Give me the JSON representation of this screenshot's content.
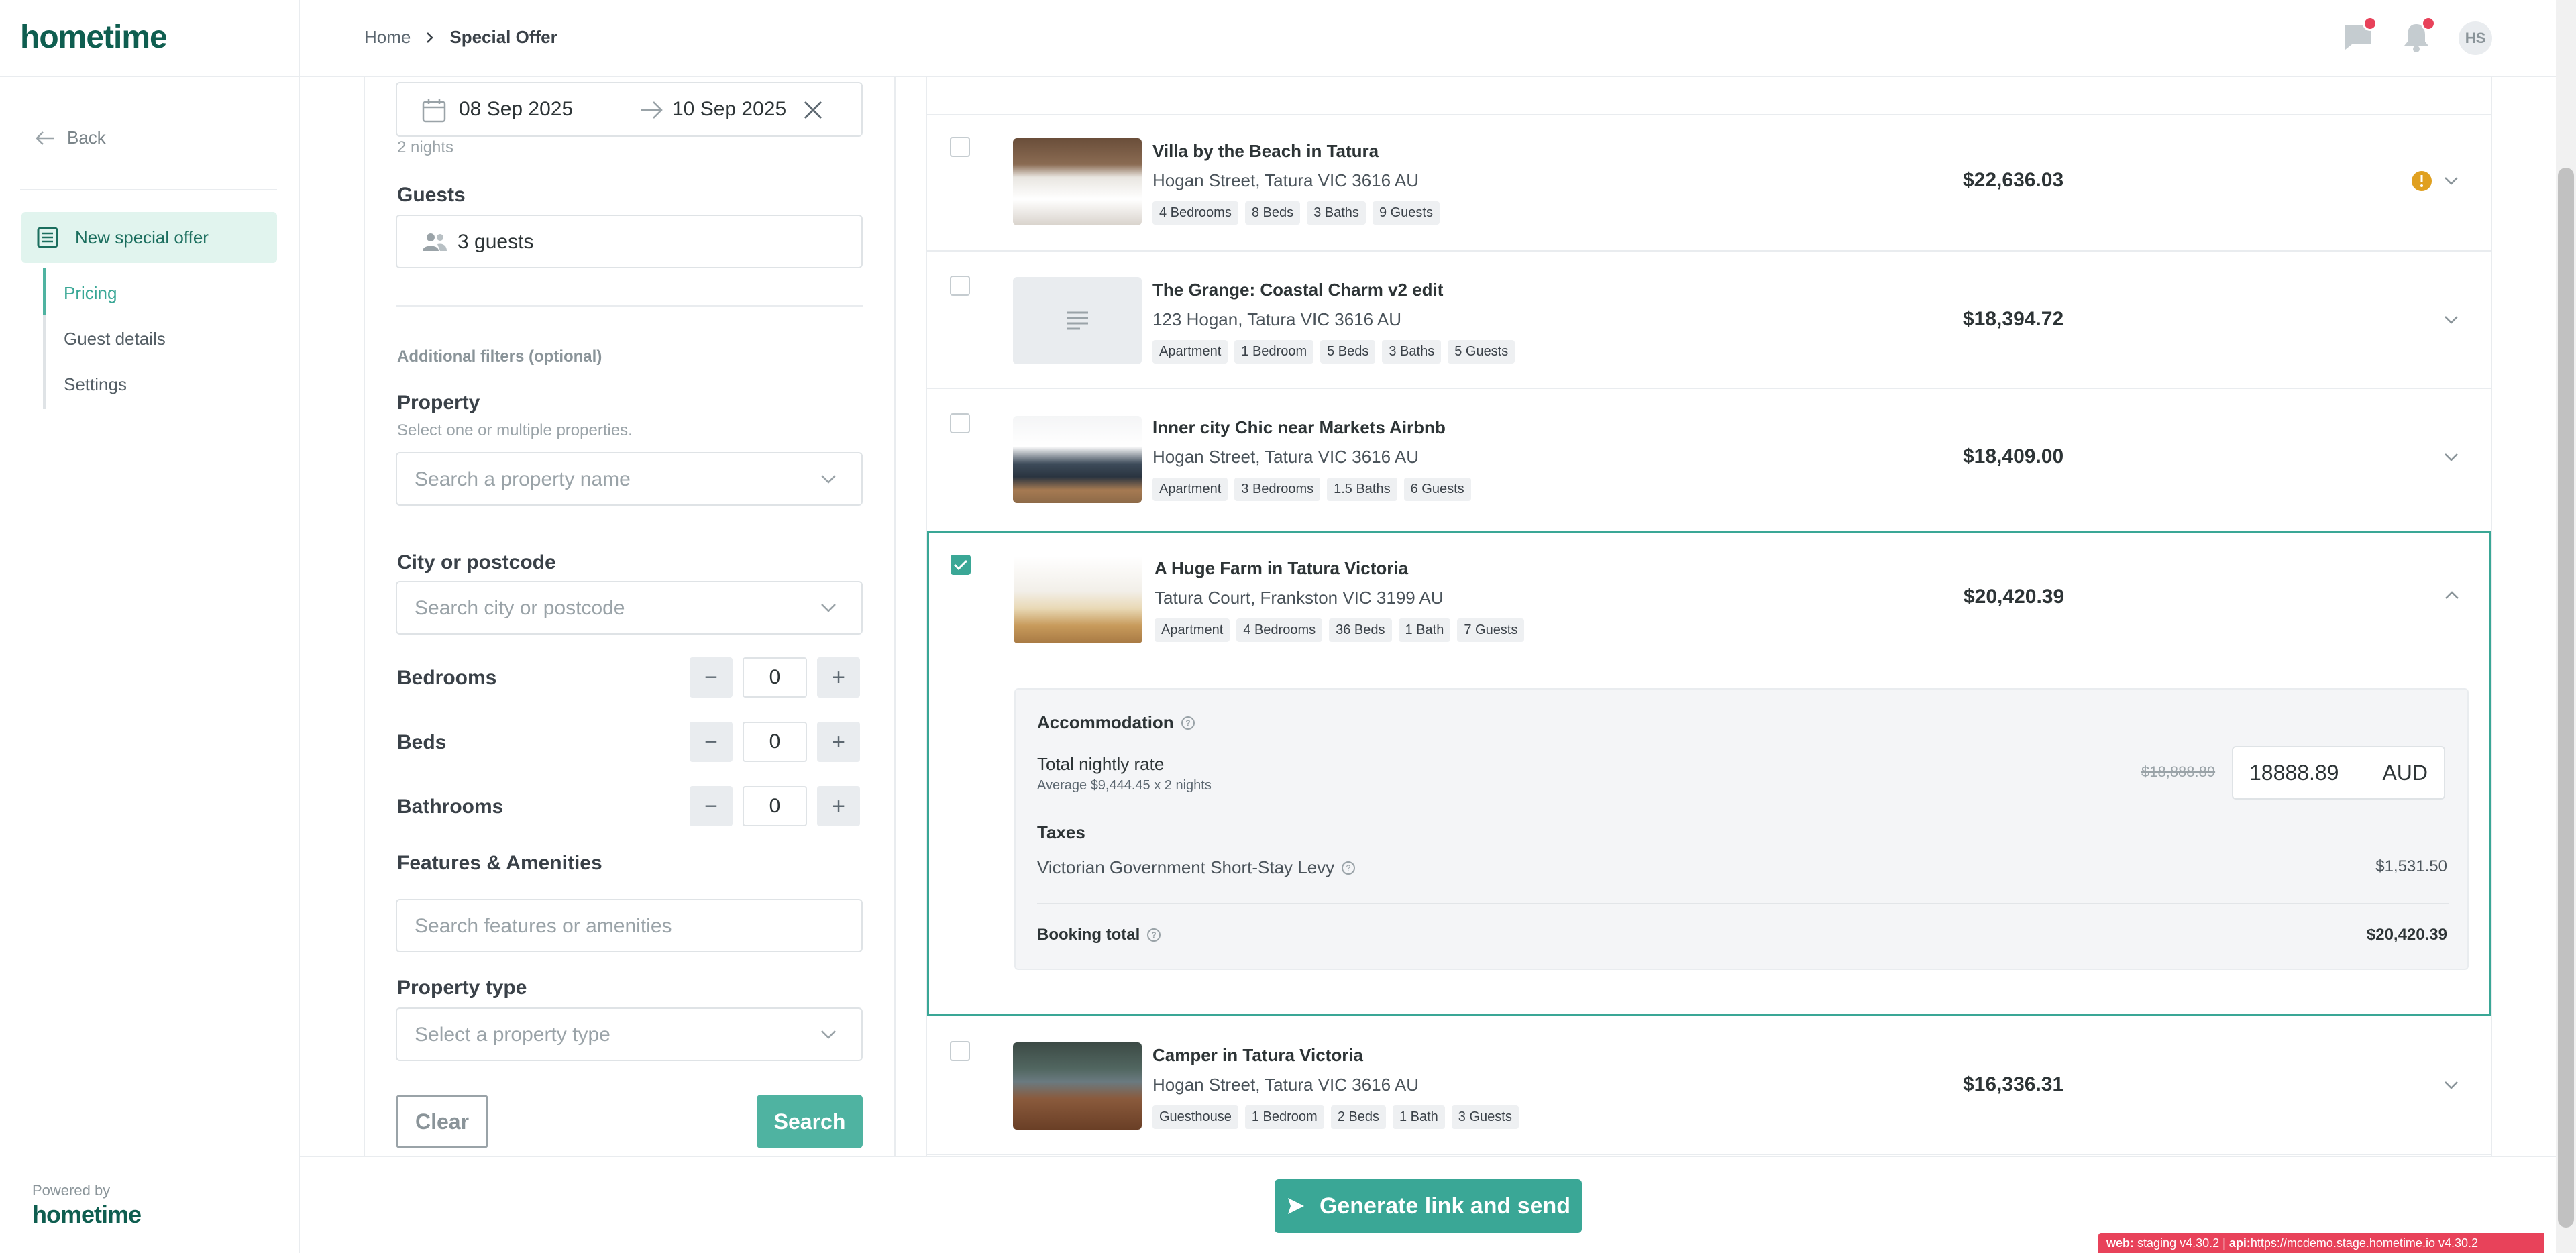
{
  "header": {
    "logo": "hometime",
    "breadcrumb": {
      "home": "Home",
      "current": "Special Offer"
    },
    "avatar": "HS"
  },
  "nav": {
    "back": "Back",
    "new_offer": "New special offer",
    "sub_items": [
      "Pricing",
      "Guest details",
      "Settings"
    ],
    "powered_by": "Powered by",
    "powered_logo": "hometime"
  },
  "form": {
    "check_in": "08 Sep 2025",
    "check_out": "10 Sep 2025",
    "nights": "2 nights",
    "guests_label": "Guests",
    "guests_value": "3 guests",
    "additional_filters": "Additional filters (optional)",
    "property_label": "Property",
    "property_hint": "Select one or multiple properties.",
    "property_placeholder": "Search a property name",
    "city_label": "City or postcode",
    "city_placeholder": "Search city or postcode",
    "bedrooms_label": "Bedrooms",
    "bedrooms_value": "0",
    "beds_label": "Beds",
    "beds_value": "0",
    "bathrooms_label": "Bathrooms",
    "bathrooms_value": "0",
    "features_label": "Features & Amenities",
    "features_placeholder": "Search features or amenities",
    "type_label": "Property type",
    "type_placeholder": "Select a property type",
    "clear": "Clear",
    "search": "Search"
  },
  "results": [
    {
      "name": "Villa by the Beach in Tatura",
      "address": "Hogan Street, Tatura VIC 3616 AU",
      "tags": [
        "4 Bedrooms",
        "8 Beds",
        "3 Baths",
        "9 Guests"
      ],
      "price": "$22,636.03",
      "checked": false,
      "warning": true
    },
    {
      "name": "The Grange: Coastal Charm v2 edit",
      "address": "123 Hogan, Tatura VIC 3616 AU",
      "tags": [
        "Apartment",
        "1 Bedroom",
        "5 Beds",
        "3 Baths",
        "5 Guests"
      ],
      "price": "$18,394.72",
      "checked": false,
      "no_image": true
    },
    {
      "name": "Inner city Chic near Markets Airbnb",
      "address": "Hogan Street, Tatura VIC 3616 AU",
      "tags": [
        "Apartment",
        "3 Bedrooms",
        "1.5 Baths",
        "6 Guests"
      ],
      "price": "$18,409.00",
      "checked": false
    },
    {
      "name": "A Huge Farm in Tatura Victoria",
      "address": "Tatura Court, Frankston VIC 3199 AU",
      "tags": [
        "Apartment",
        "4 Bedrooms",
        "36 Beds",
        "1 Bath",
        "7 Guests"
      ],
      "price": "$20,420.39",
      "checked": true
    },
    {
      "name": "Camper in Tatura Victoria",
      "address": "Hogan Street, Tatura VIC 3616 AU",
      "tags": [
        "Guesthouse",
        "1 Bedroom",
        "2 Beds",
        "1 Bath",
        "3 Guests"
      ],
      "price": "$16,336.31",
      "checked": false
    }
  ],
  "detail": {
    "accommodation": "Accommodation",
    "nightly_label": "Total nightly rate",
    "nightly_sub": "Average $9,444.45 x 2 nights",
    "original_price": "$18,888.89",
    "rate_value": "18888.89",
    "currency": "AUD",
    "taxes": "Taxes",
    "levy_label": "Victorian Government Short-Stay Levy",
    "levy_value": "$1,531.50",
    "total_label": "Booking total",
    "total_value": "$20,420.39"
  },
  "footer": {
    "generate": "Generate link and send",
    "env_web_label": "web:",
    "env_web": "staging v4.30.2 |",
    "env_api_label": "api:",
    "env_api": "https://mcdemo.stage.hometime.io v4.30.2"
  },
  "colors": {
    "brand": "#0f5e50",
    "accent": "#3aa796",
    "alert": "#e8425a",
    "warning": "#e0a020"
  }
}
